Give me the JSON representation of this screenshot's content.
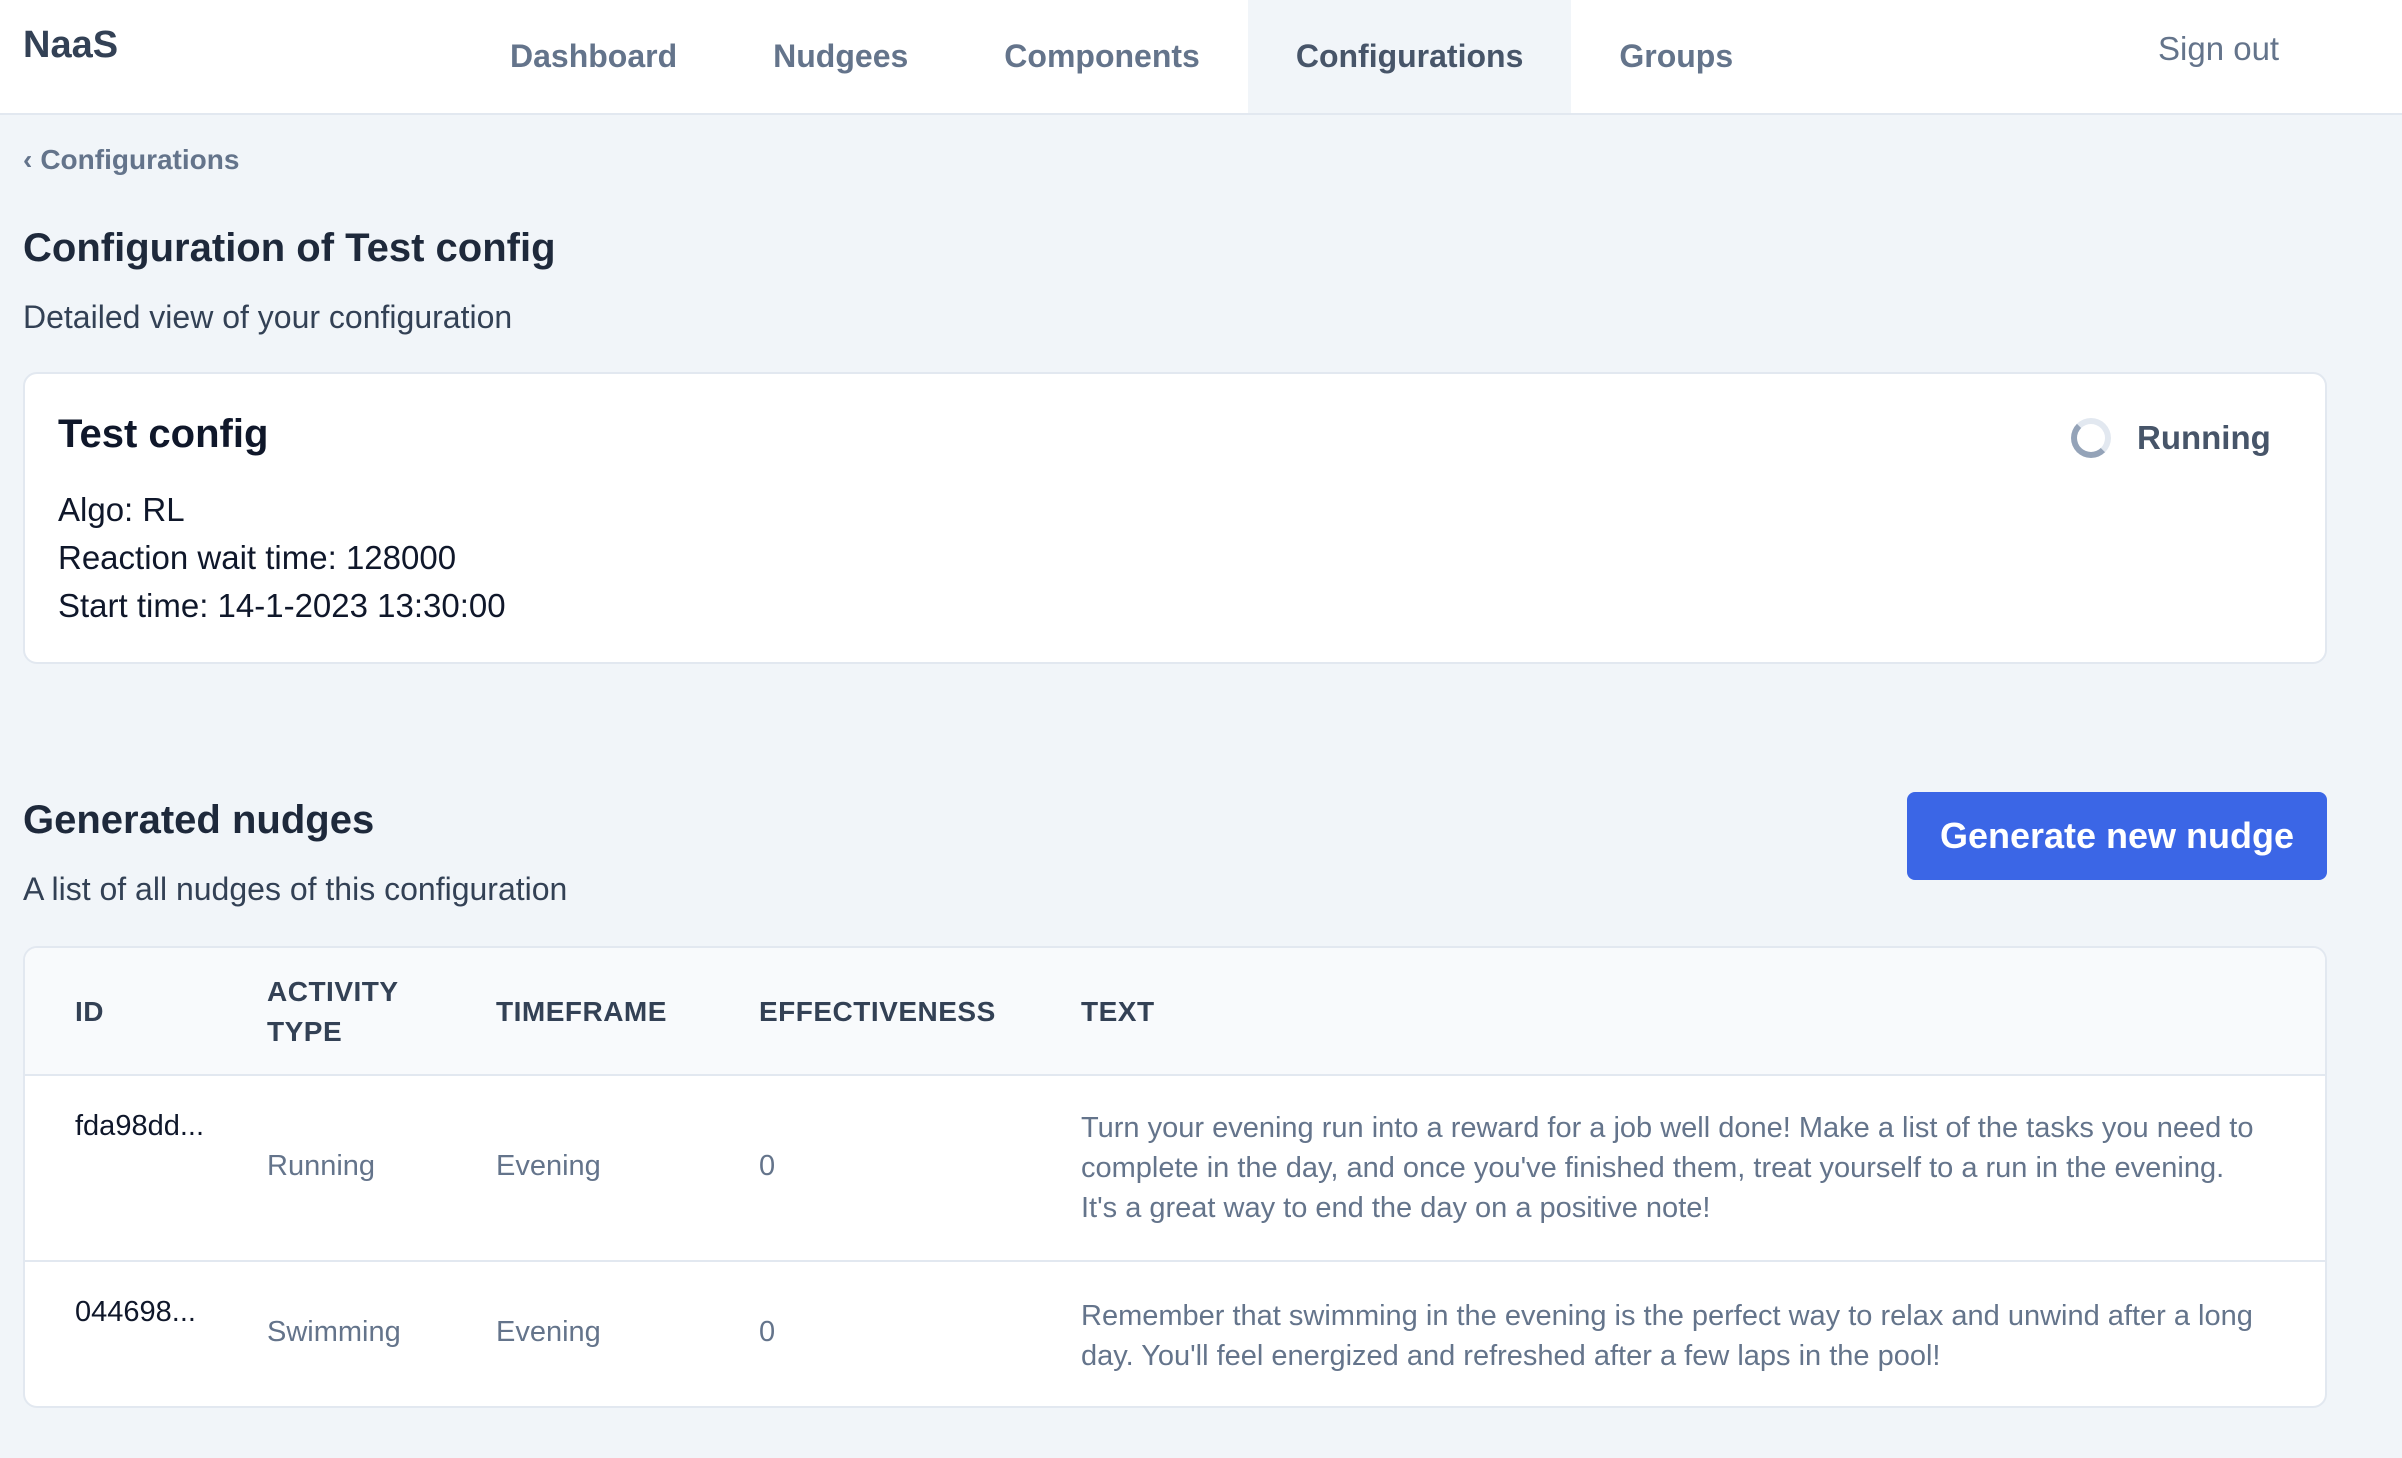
{
  "brand": "NaaS",
  "nav": {
    "items": [
      "Dashboard",
      "Nudgees",
      "Components",
      "Configurations",
      "Groups"
    ],
    "active": "Configurations",
    "signout": "Sign out"
  },
  "breadcrumb": {
    "chevron": "‹",
    "label": "Configurations"
  },
  "header": {
    "title": "Configuration of Test config",
    "subtitle": "Detailed view of your configuration"
  },
  "config": {
    "name": "Test config",
    "algo": "Algo: RL",
    "wait": "Reaction wait time: 128000",
    "start": "Start time: 14-1-2023 13:30:00",
    "status": "Running"
  },
  "nudges": {
    "title": "Generated nudges",
    "subtitle": "A list of all nudges of this configuration",
    "button": "Generate new nudge",
    "columns": {
      "id": "ID",
      "activity_1": "ACTIVITY",
      "activity_2": "TYPE",
      "timeframe": "TIMEFRAME",
      "effectiveness": "EFFECTIVENESS",
      "text": "TEXT"
    },
    "rows": [
      {
        "id": "fda98dd...",
        "activity": "Running",
        "timeframe": "Evening",
        "effectiveness": "0",
        "text": "Turn your evening run into a reward for a job well done! Make a list of the tasks you need to complete in the day, and once you've finished them, treat yourself to a run in the evening. It's a great way to end the day on a positive note!"
      },
      {
        "id": "044698...",
        "activity": "Swimming",
        "timeframe": "Evening",
        "effectiveness": "0",
        "text": "Remember that swimming in the evening is the perfect way to relax and unwind after a long day. You'll feel energized and refreshed after a few laps in the pool!"
      }
    ]
  },
  "colors": {
    "accent": "#3b66e6",
    "background": "#f1f5f9"
  }
}
